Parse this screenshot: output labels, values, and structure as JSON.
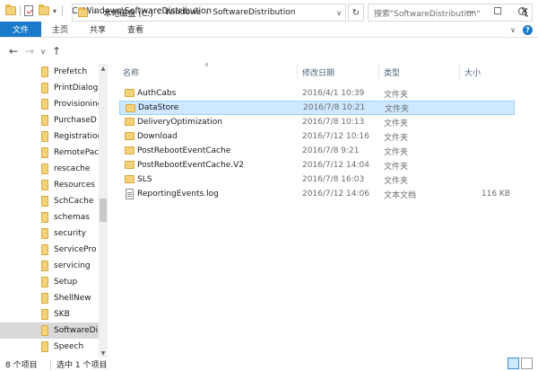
{
  "window": {
    "title": "C:\\Windows\\SoftwareDistribution",
    "min_glyph": "—",
    "max_glyph": "☐",
    "close_glyph": "✕"
  },
  "ribbon": {
    "tabs": [
      "文件",
      "主页",
      "共享",
      "查看"
    ]
  },
  "address": {
    "overflow": "«",
    "crumbs": [
      "本地磁盘 (C:)",
      "Windows",
      "SoftwareDistribution"
    ],
    "chev": "›"
  },
  "search": {
    "placeholder": "搜索\"SoftwareDistribution\""
  },
  "nav_pane": {
    "items": [
      "Prefetch",
      "PrintDialog",
      "Provisioning",
      "PurchaseD",
      "Registration",
      "RemotePac",
      "rescache",
      "Resources",
      "SchCache",
      "schemas",
      "security",
      "ServicePro",
      "servicing",
      "Setup",
      "ShellNew",
      "SKB",
      "SoftwareDi",
      "Speech"
    ],
    "selected_index": 16
  },
  "columns": {
    "name": "名称",
    "date": "修改日期",
    "type": "类型",
    "size": "大小"
  },
  "files": [
    {
      "name": "AuthCabs",
      "date": "2016/4/1 10:39",
      "type": "文件夹",
      "size": "",
      "kind": "folder"
    },
    {
      "name": "DataStore",
      "date": "2016/7/8 10:21",
      "type": "文件夹",
      "size": "",
      "kind": "folder",
      "selected": true
    },
    {
      "name": "DeliveryOptimization",
      "date": "2016/7/8 10:13",
      "type": "文件夹",
      "size": "",
      "kind": "folder"
    },
    {
      "name": "Download",
      "date": "2016/7/12 10:16",
      "type": "文件夹",
      "size": "",
      "kind": "folder"
    },
    {
      "name": "PostRebootEventCache",
      "date": "2016/7/8 9:21",
      "type": "文件夹",
      "size": "",
      "kind": "folder"
    },
    {
      "name": "PostRebootEventCache.V2",
      "date": "2016/7/12 14:04",
      "type": "文件夹",
      "size": "",
      "kind": "folder"
    },
    {
      "name": "SLS",
      "date": "2016/7/8 16:03",
      "type": "文件夹",
      "size": "",
      "kind": "folder"
    },
    {
      "name": "ReportingEvents.log",
      "date": "2016/7/12 14:06",
      "type": "文本文档",
      "size": "116 KB",
      "kind": "file"
    }
  ],
  "status": {
    "count": "8 个项目",
    "selection": "选中 1 个项目"
  },
  "colors": {
    "accent": "#1979ca",
    "selection_bg": "#cde8ff",
    "selection_border": "#99d1ff",
    "folder": "#f3d27a"
  }
}
